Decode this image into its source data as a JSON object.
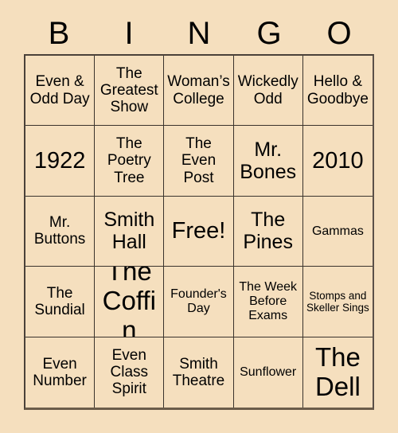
{
  "card": {
    "background_color": "#f5dfbe",
    "text_color": "#000000",
    "grid_line_color": "#3a332c",
    "header": {
      "letters": [
        "B",
        "I",
        "N",
        "G",
        "O"
      ]
    },
    "rows": [
      [
        {
          "text": "Even & Odd Day",
          "size": "md"
        },
        {
          "text": "The Greatest Show",
          "size": "md"
        },
        {
          "text": "Woman’s College",
          "size": "md"
        },
        {
          "text": "Wickedly Odd",
          "size": "md"
        },
        {
          "text": "Hello & Goodbye",
          "size": "md"
        }
      ],
      [
        {
          "text": "1922",
          "size": "xl"
        },
        {
          "text": "The Poetry Tree",
          "size": "md"
        },
        {
          "text": "The Even Post",
          "size": "md"
        },
        {
          "text": "Mr. Bones",
          "size": "lg"
        },
        {
          "text": "2010",
          "size": "xl"
        }
      ],
      [
        {
          "text": "Mr. Buttons",
          "size": "md"
        },
        {
          "text": "Smith Hall",
          "size": "lg"
        },
        {
          "text": "Free!",
          "size": "xl"
        },
        {
          "text": "The Pines",
          "size": "lg"
        },
        {
          "text": "Gammas",
          "size": "sm"
        }
      ],
      [
        {
          "text": "The Sundial",
          "size": "md"
        },
        {
          "text": "The Coffin",
          "size": "xxl"
        },
        {
          "text": "Founder's Day",
          "size": "sm"
        },
        {
          "text": "The Week Before Exams",
          "size": "sm"
        },
        {
          "text": "Stomps and Skeller Sings",
          "size": "xs"
        }
      ],
      [
        {
          "text": "Even Number",
          "size": "md"
        },
        {
          "text": "Even Class Spirit",
          "size": "md"
        },
        {
          "text": "Smith Theatre",
          "size": "md"
        },
        {
          "text": "Sunflower",
          "size": "sm"
        },
        {
          "text": "The Dell",
          "size": "xxl"
        }
      ]
    ]
  }
}
